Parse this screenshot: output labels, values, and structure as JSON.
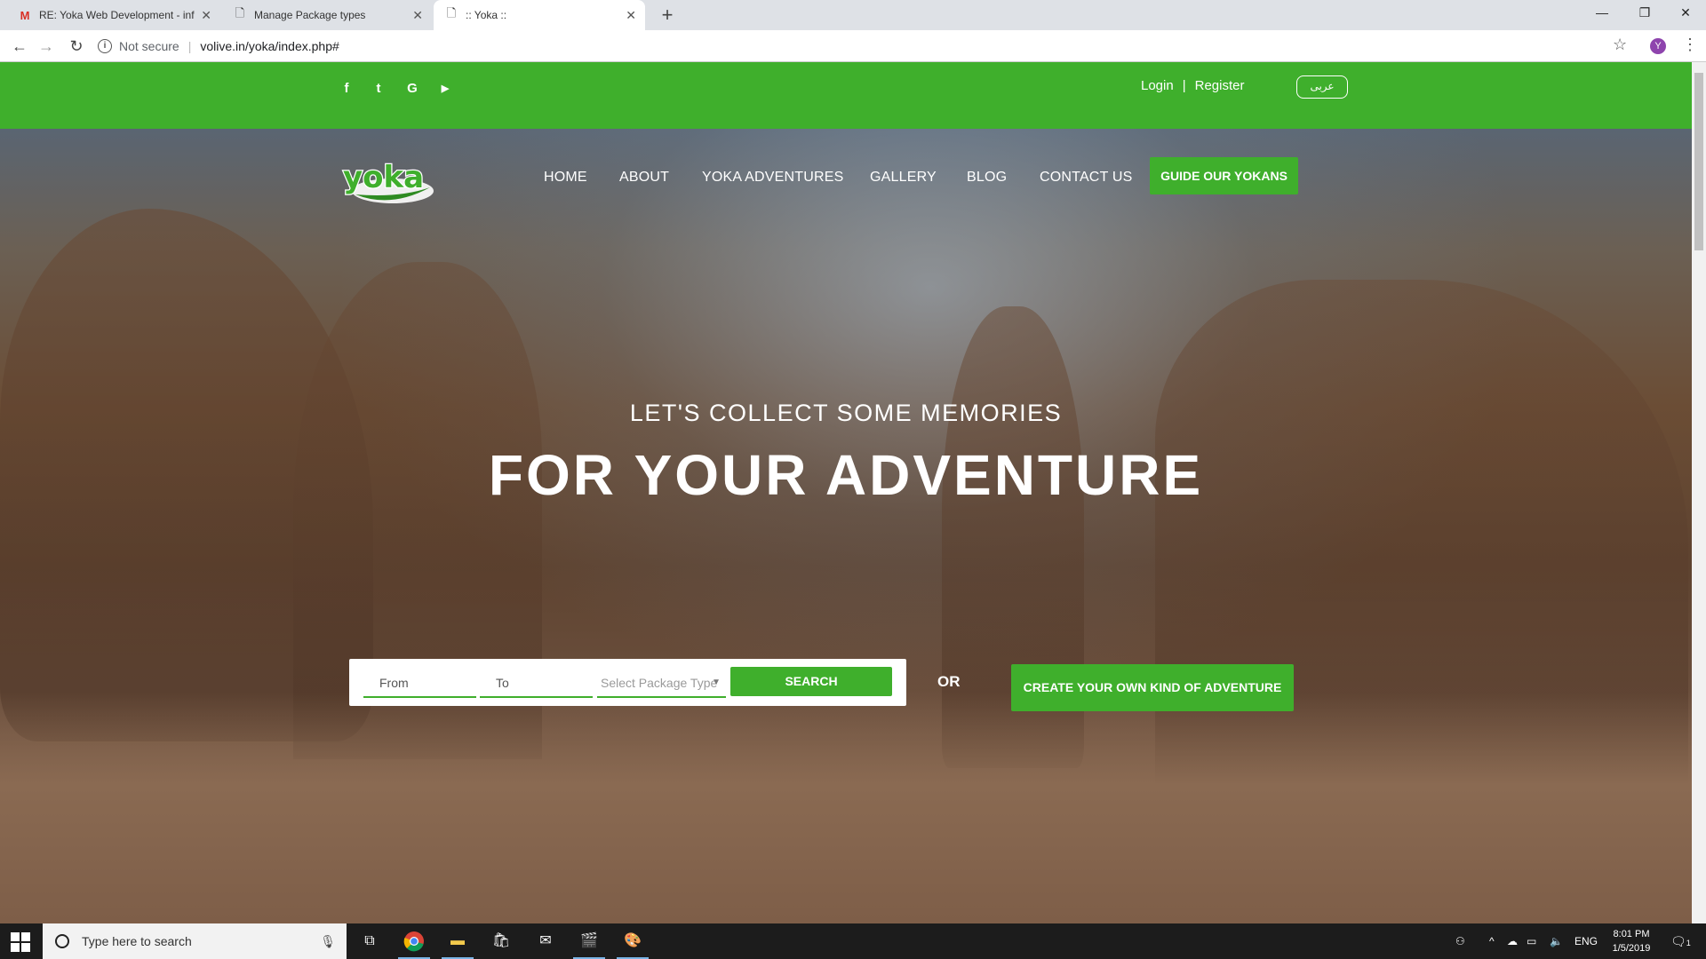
{
  "browser": {
    "tabs": [
      {
        "title": "RE: Yoka Web Development - inf",
        "icon": "gmail-icon"
      },
      {
        "title": "Manage Package types",
        "icon": "page-icon"
      },
      {
        "title": ":: Yoka ::",
        "icon": "page-icon"
      }
    ],
    "new_tab": "+",
    "security_label": "Not secure",
    "url": "volive.in/yoka/index.php#",
    "profile_initial": "Y"
  },
  "site": {
    "social": [
      {
        "name": "facebook",
        "glyph": "f"
      },
      {
        "name": "twitter",
        "glyph": "t"
      },
      {
        "name": "google",
        "glyph": "G"
      },
      {
        "name": "youtube",
        "glyph": "▶"
      }
    ],
    "login_label": "Login",
    "separator": "|",
    "register_label": "Register",
    "language_button": "عربى",
    "logo_text": "yoka",
    "nav": [
      "HOME",
      "ABOUT",
      "YOKA ADVENTURES",
      "GALLERY",
      "BLOG",
      "CONTACT US"
    ],
    "guide_button": "GUIDE OUR YOKANS",
    "subheading": "LET'S COLLECT SOME MEMORIES",
    "heading": "FOR YOUR ADVENTURE",
    "search": {
      "from_placeholder": "From",
      "to_placeholder": "To",
      "package_placeholder": "Select Package Type",
      "button": "SEARCH"
    },
    "or_label": "OR",
    "create_button": "CREATE YOUR OWN KIND OF ADVENTURE",
    "accent_color": "#3faf2c"
  },
  "taskbar": {
    "search_placeholder": "Type here to search",
    "language": "ENG",
    "time": "8:01 PM",
    "date": "1/5/2019",
    "notification_count": "1"
  }
}
